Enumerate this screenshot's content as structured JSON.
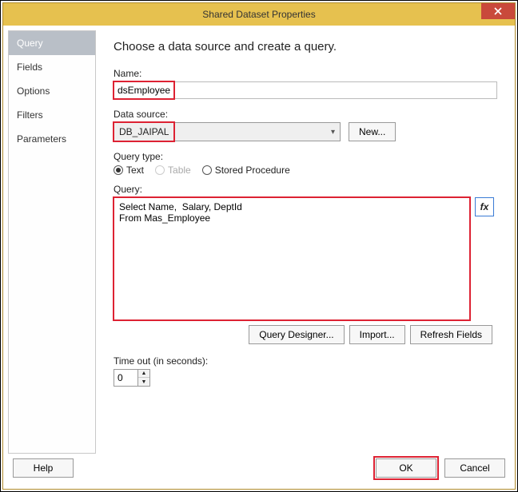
{
  "window": {
    "title": "Shared Dataset Properties"
  },
  "sidebar": {
    "items": [
      {
        "label": "Query",
        "selected": true
      },
      {
        "label": "Fields"
      },
      {
        "label": "Options"
      },
      {
        "label": "Filters"
      },
      {
        "label": "Parameters"
      }
    ]
  },
  "main": {
    "heading": "Choose a data source and create a query.",
    "name_label": "Name:",
    "name_value": "dsEmployee",
    "datasource_label": "Data source:",
    "datasource_value": "DB_JAIPAL",
    "new_btn": "New...",
    "querytype_label": "Query type:",
    "qt_text": "Text",
    "qt_table": "Table",
    "qt_sp": "Stored Procedure",
    "query_label": "Query:",
    "query_value": "Select Name,  Salary, DeptId\nFrom Mas_Employee",
    "fx_label": "fx",
    "qd_btn": "Query Designer...",
    "import_btn": "Import...",
    "refresh_btn": "Refresh Fields",
    "timeout_label": "Time out (in seconds):",
    "timeout_value": "0"
  },
  "footer": {
    "help": "Help",
    "ok": "OK",
    "cancel": "Cancel"
  }
}
